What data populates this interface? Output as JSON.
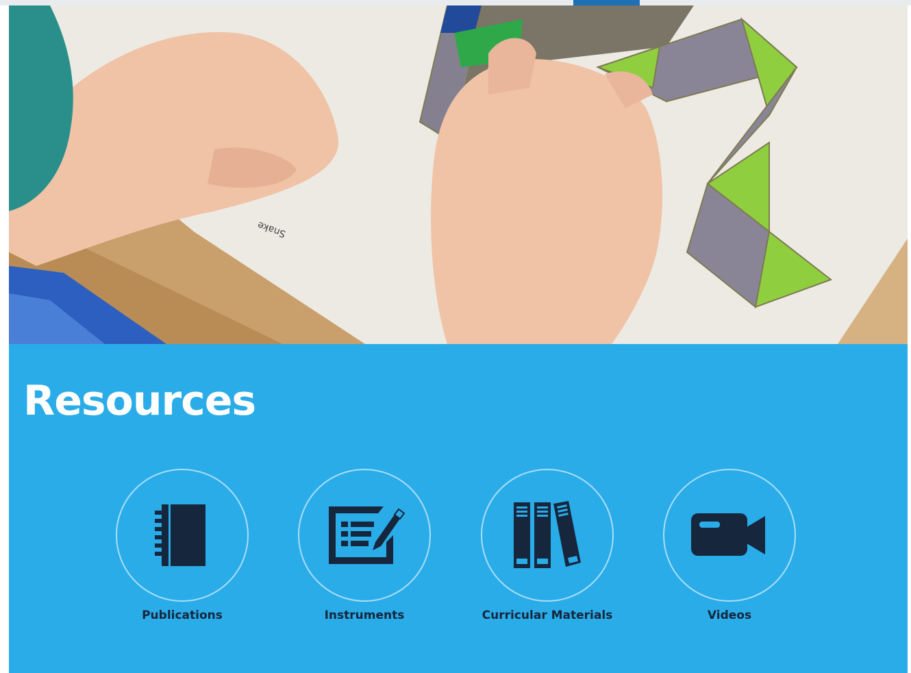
{
  "nav": {
    "active_tab": "active-nav-tab"
  },
  "hero": {
    "card_label": "Snake",
    "image": "photo-of-hands-arranging-tangram-pattern-blocks"
  },
  "resources": {
    "title": "Resources",
    "background": "#2aace9",
    "icon_color": "#16263d",
    "items": [
      {
        "label": "Publications",
        "icon": "notebook-icon"
      },
      {
        "label": "Instruments",
        "icon": "form-with-pencil-icon"
      },
      {
        "label": "Curricular Materials",
        "icon": "books-icon"
      },
      {
        "label": "Videos",
        "icon": "video-camera-icon"
      }
    ]
  }
}
